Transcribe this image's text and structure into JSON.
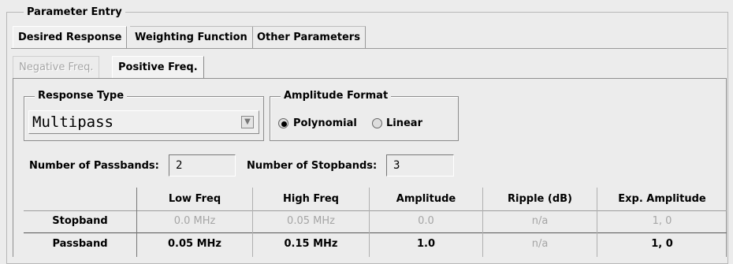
{
  "group_title": "Parameter Entry",
  "tabs": [
    {
      "label": "Desired Response",
      "active": true
    },
    {
      "label": "Weighting Function",
      "active": false
    },
    {
      "label": "Other Parameters",
      "active": false
    }
  ],
  "subtabs": [
    {
      "label": "Negative Freq.",
      "enabled": false
    },
    {
      "label": "Positive Freq.",
      "active": true
    }
  ],
  "response_type": {
    "legend": "Response Type",
    "selected": "Multipass"
  },
  "amplitude_format": {
    "legend": "Amplitude Format",
    "options": [
      {
        "label": "Polynomial",
        "checked": true
      },
      {
        "label": "Linear",
        "checked": false
      }
    ]
  },
  "passbands": {
    "label": "Number of Passbands:",
    "value": "2"
  },
  "stopbands": {
    "label": "Number of Stopbands:",
    "value": "3"
  },
  "table": {
    "columns": [
      "Low Freq",
      "High Freq",
      "Amplitude",
      "Ripple (dB)",
      "Exp. Amplitude"
    ],
    "rows": [
      {
        "label": "Stopband",
        "cells": [
          "0.0 MHz",
          "0.05 MHz",
          "0.0",
          "n/a",
          "1, 0"
        ],
        "enabled": false
      },
      {
        "label": "Passband",
        "cells": [
          "0.05 MHz",
          "0.15 MHz",
          "1.0",
          "n/a",
          "1, 0"
        ],
        "enabled": true
      }
    ]
  }
}
